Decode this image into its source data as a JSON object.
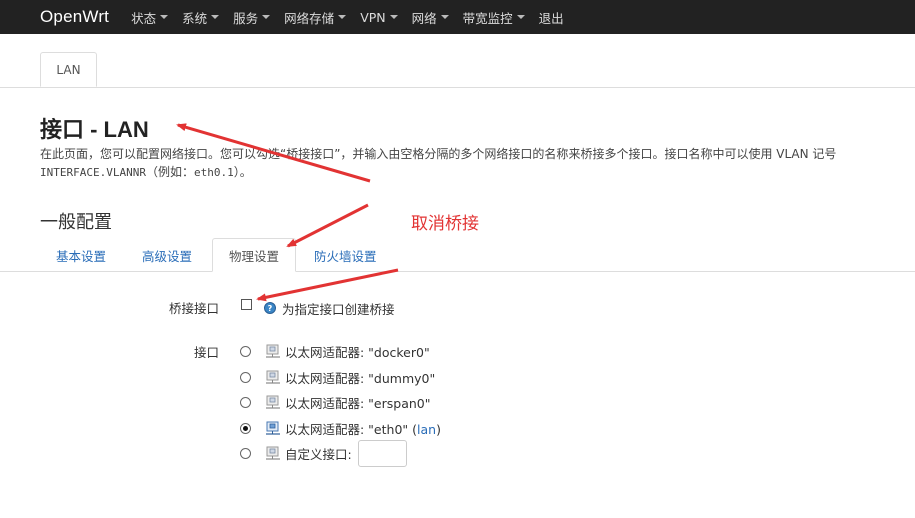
{
  "navbar": {
    "brand": "OpenWrt",
    "items": [
      {
        "label": "状态",
        "dropdown": true
      },
      {
        "label": "系统",
        "dropdown": true
      },
      {
        "label": "服务",
        "dropdown": true
      },
      {
        "label": "网络存储",
        "dropdown": true
      },
      {
        "label": "VPN",
        "dropdown": true
      },
      {
        "label": "网络",
        "dropdown": true
      },
      {
        "label": "带宽监控",
        "dropdown": true
      },
      {
        "label": "退出",
        "dropdown": false
      }
    ]
  },
  "top_tabs": [
    {
      "label": "LAN",
      "active": true
    }
  ],
  "page": {
    "title": "接口 - LAN",
    "description_line1": "在此页面，您可以配置网络接口。您可以勾选“桥接接口”，并输入由空格分隔的多个网络接口的名称来桥接多个接口。接口名称中可以使用 VLAN 记号",
    "description_code": "INTERFACE.VLANNR",
    "description_line2_mid": "（例如：",
    "description_code2": "eth0.1",
    "description_line2_end": "）。"
  },
  "section": {
    "title": "一般配置",
    "tabs": [
      {
        "label": "基本设置",
        "active": false
      },
      {
        "label": "高级设置",
        "active": false
      },
      {
        "label": "物理设置",
        "active": true
      },
      {
        "label": "防火墙设置",
        "active": false
      }
    ]
  },
  "annotation": {
    "text": "取消桥接",
    "color": "#e23333"
  },
  "form": {
    "bridge": {
      "label": "桥接接口",
      "checked": false,
      "help_text": "为指定接口创建桥接"
    },
    "interface": {
      "label": "接口",
      "options": [
        {
          "text": "以太网适配器: \"docker0\"",
          "suffix": "",
          "checked": false
        },
        {
          "text": "以太网适配器: \"dummy0\"",
          "suffix": "",
          "checked": false
        },
        {
          "text": "以太网适配器: \"erspan0\"",
          "suffix": "",
          "checked": false
        },
        {
          "text": "以太网适配器: \"eth0\" (",
          "suffix": "lan",
          "suffix_end": ")",
          "checked": true
        }
      ],
      "custom": {
        "label": "自定义接口:",
        "value": "",
        "checked": false
      }
    }
  }
}
